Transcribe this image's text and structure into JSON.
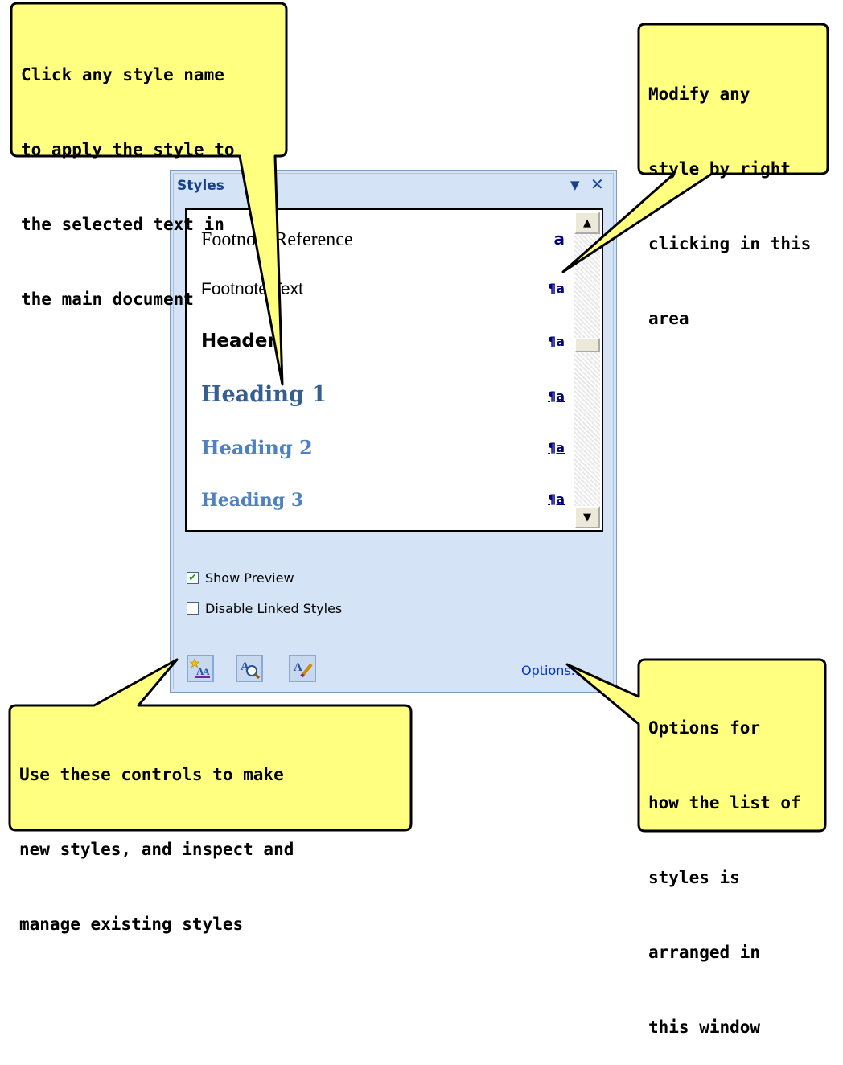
{
  "pane": {
    "title": "Styles",
    "menu_glyph": "▼",
    "close_glyph": "✕",
    "styles": [
      {
        "name": "Footnote Reference",
        "type": "character",
        "mark": "a"
      },
      {
        "name": "Footnote Text",
        "type": "paragraph",
        "mark": "¶a"
      },
      {
        "name": "Header",
        "type": "paragraph",
        "mark": "¶a"
      },
      {
        "name": "Heading 1",
        "type": "paragraph",
        "mark": "¶a"
      },
      {
        "name": "Heading 2",
        "type": "paragraph",
        "mark": "¶a"
      },
      {
        "name": "Heading 3",
        "type": "paragraph",
        "mark": "¶a"
      }
    ],
    "show_preview": {
      "label": "Show Preview",
      "checked": true
    },
    "disable_linked": {
      "label": "Disable Linked Styles",
      "checked": false
    },
    "buttons": {
      "new_style": "new-style-icon",
      "style_inspector": "style-inspector-icon",
      "manage_styles": "manage-styles-icon"
    },
    "options_label": "Options..."
  },
  "callouts": {
    "apply": {
      "lines": [
        "Click any style name",
        "to apply the style to",
        "the selected text in",
        "the main document"
      ]
    },
    "modify": {
      "lines": [
        "Modify any",
        "style by right",
        "clicking in this",
        "area"
      ]
    },
    "controls": {
      "lines": [
        "Use these controls to make",
        "new styles, and inspect and",
        "manage existing styles"
      ]
    },
    "options": {
      "lines": [
        "Options for",
        "how the list of",
        "styles is",
        "arranged in",
        "this window"
      ]
    }
  },
  "colors": {
    "callout_fill": "#ffff80",
    "heading_color": "#365f91",
    "heading_light": "#4f81bd",
    "link": "#0033cc",
    "mark": "#000080"
  }
}
